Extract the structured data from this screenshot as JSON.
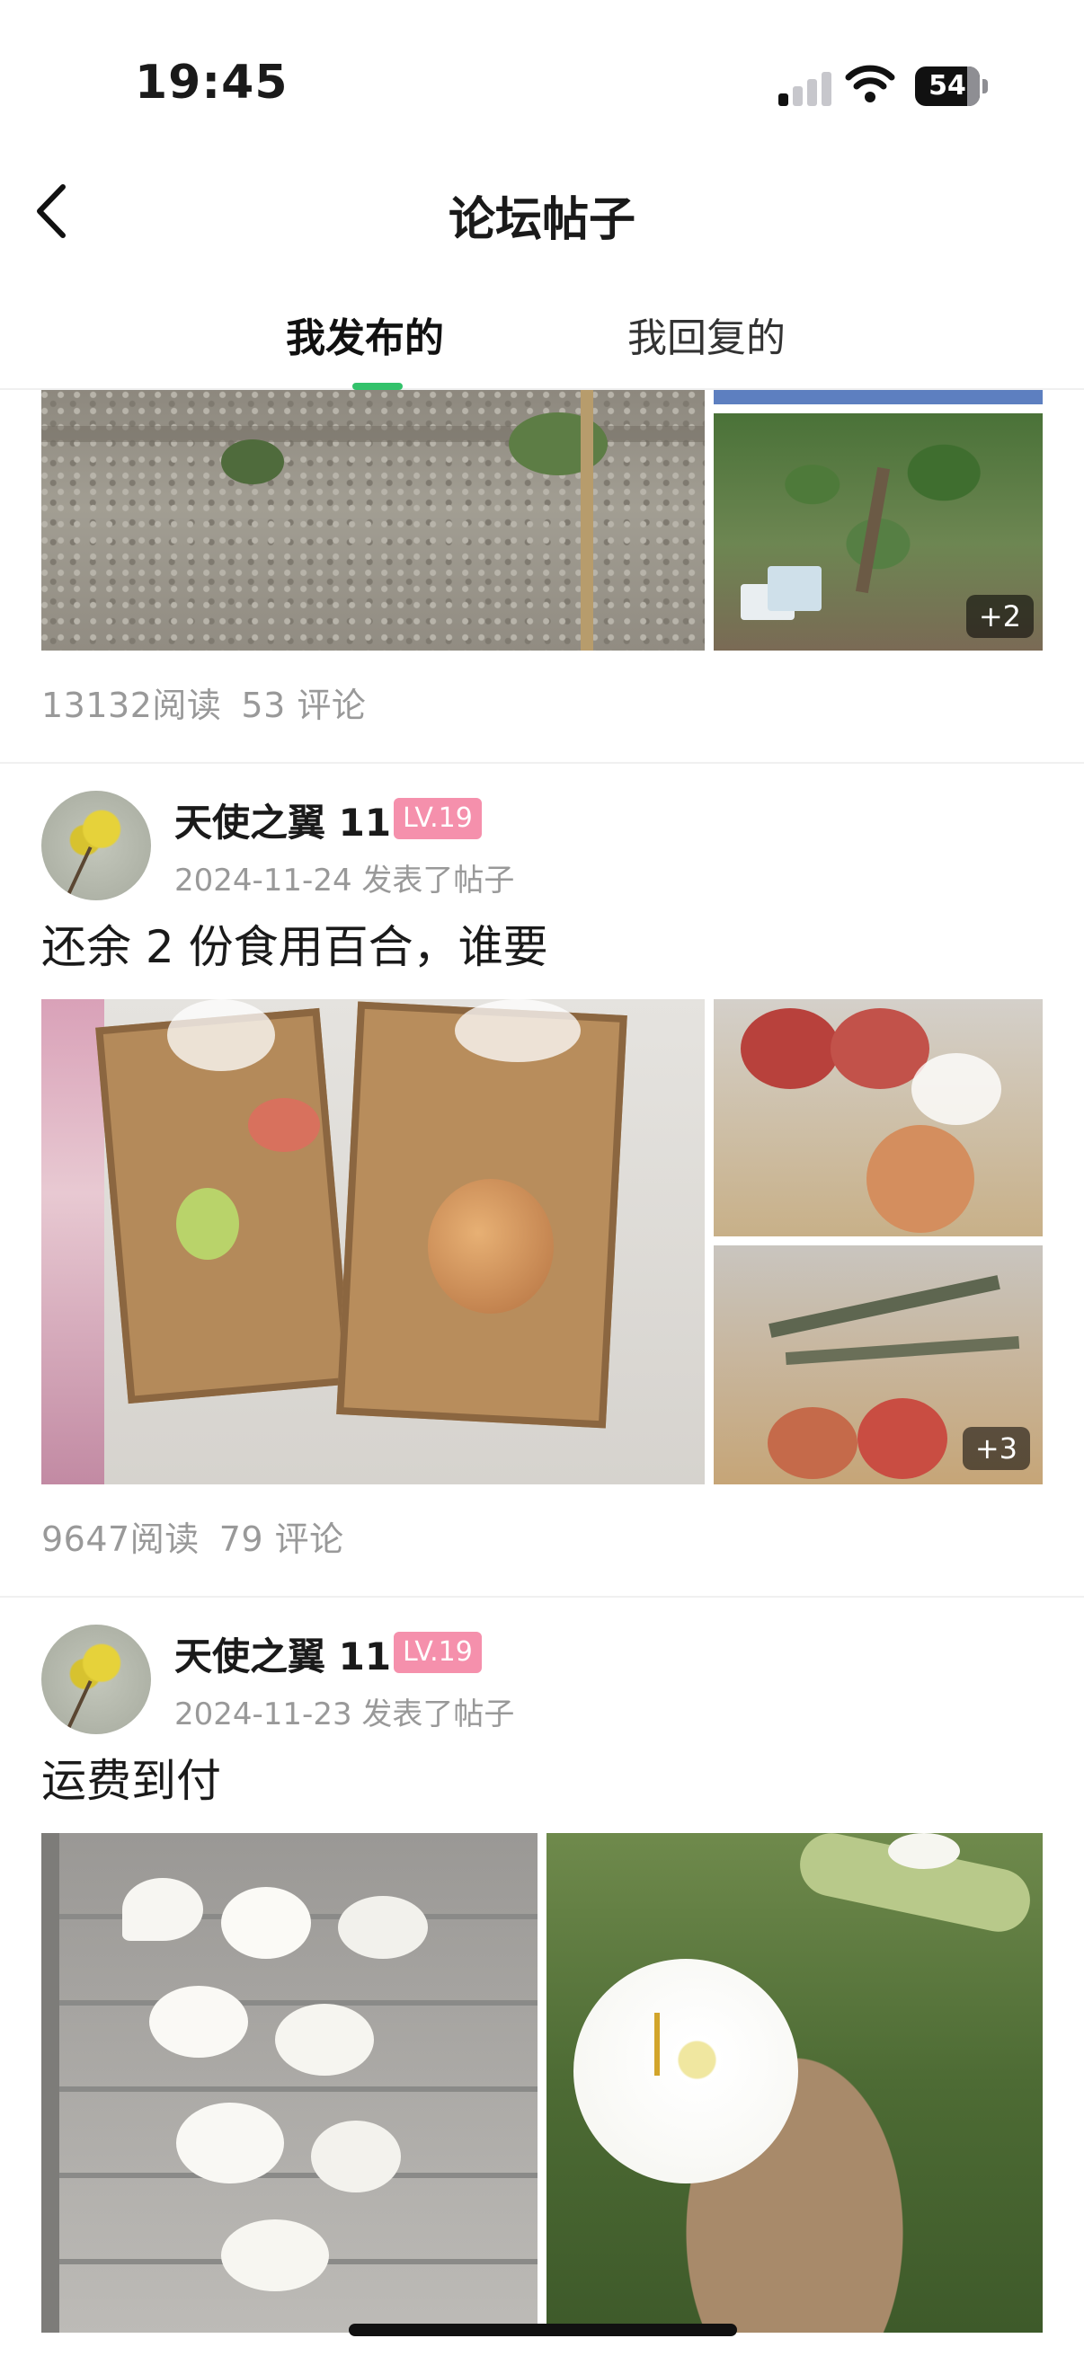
{
  "status_bar": {
    "time": "19:45",
    "battery": "54"
  },
  "nav": {
    "title": "论坛帖子"
  },
  "tabs": [
    {
      "label": "我发布的",
      "active": true
    },
    {
      "label": "我回复的",
      "active": false
    }
  ],
  "posts": [
    {
      "more_count": "+2",
      "reads": "13132阅读",
      "comments": "53 评论"
    },
    {
      "author": "天使之翼 11",
      "level": "LV.19",
      "date_action": "2024-11-24 发表了帖子",
      "title": "还余 2 份食用百合，谁要",
      "more_count": "+3",
      "reads": "9647阅读",
      "comments": "79 评论"
    },
    {
      "author": "天使之翼 11",
      "level": "LV.19",
      "date_action": "2024-11-23 发表了帖子",
      "title": "运费到付"
    }
  ],
  "colors": {
    "accent": "#33c26b",
    "level_badge": "#f590ac",
    "meta_text": "#999999"
  }
}
